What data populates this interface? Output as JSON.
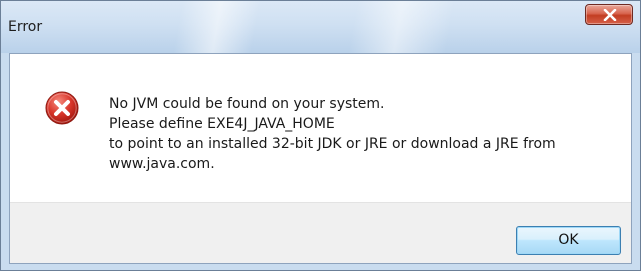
{
  "window": {
    "title": "Error"
  },
  "titlebar": {
    "close_icon": "close-x-icon"
  },
  "dialog": {
    "icon": "error-icon",
    "message_lines": [
      "No JVM could be found on your system.",
      "Please define EXE4J_JAVA_HOME",
      "to point to an installed 32-bit JDK or JRE or download a JRE from",
      "www.java.com."
    ],
    "ok_label": "OK"
  },
  "colors": {
    "error_red": "#d9362b",
    "close_button": "#c94a32",
    "button_border": "#3c7fb1"
  }
}
